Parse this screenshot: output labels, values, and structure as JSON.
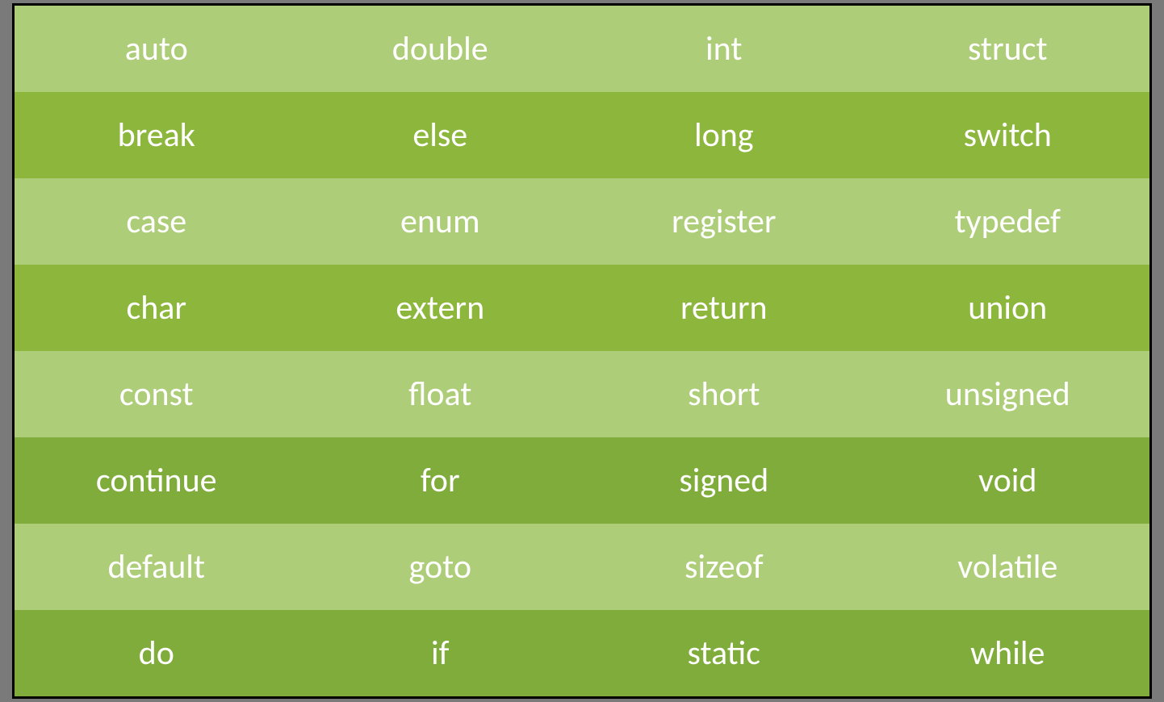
{
  "table": {
    "rows": [
      {
        "cells": [
          "auto",
          "double",
          "int",
          "struct"
        ],
        "shade": "light"
      },
      {
        "cells": [
          "break",
          "else",
          "long",
          "switch"
        ],
        "shade": "dark"
      },
      {
        "cells": [
          "case",
          "enum",
          "register",
          "typedef"
        ],
        "shade": "light"
      },
      {
        "cells": [
          "char",
          "extern",
          "return",
          "union"
        ],
        "shade": "dark"
      },
      {
        "cells": [
          "const",
          "float",
          "short",
          "unsigned"
        ],
        "shade": "light"
      },
      {
        "cells": [
          "continue",
          "for",
          "signed",
          "void"
        ],
        "shade": "darker"
      },
      {
        "cells": [
          "default",
          "goto",
          "sizeof",
          "volatile"
        ],
        "shade": "light"
      },
      {
        "cells": [
          "do",
          "if",
          "static",
          "while"
        ],
        "shade": "darker"
      }
    ]
  },
  "colors": {
    "light": "#aecd79",
    "dark": "#8cb63c",
    "darker": "#7fac3a",
    "text": "#ffffff",
    "border": "#000000",
    "page_bg": "#7a7a7a"
  }
}
